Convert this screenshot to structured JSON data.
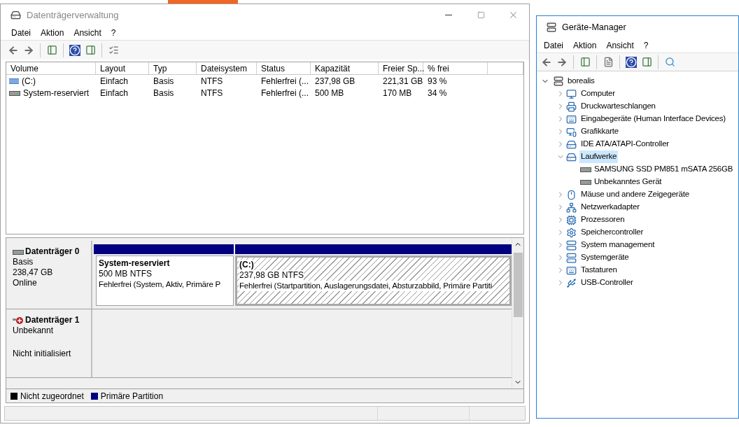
{
  "disk_management": {
    "title": "Datenträgerverwaltung",
    "menu": [
      "Datei",
      "Aktion",
      "Ansicht",
      "?"
    ],
    "volume_list": {
      "columns": [
        "Volume",
        "Layout",
        "Typ",
        "Dateisystem",
        "Status",
        "Kapazität",
        "Freier Sp...",
        "% frei"
      ],
      "rows": [
        {
          "kind": "striped",
          "cells": [
            "(C:)",
            "Einfach",
            "Basis",
            "NTFS",
            "Fehlerfrei (...",
            "237,98 GB",
            "221,31 GB",
            "93 %"
          ]
        },
        {
          "kind": "plain",
          "cells": [
            "System-reserviert",
            "Einfach",
            "Basis",
            "NTFS",
            "Fehlerfrei (...",
            "500 MB",
            "170 MB",
            "34 %"
          ]
        }
      ]
    },
    "disks": [
      {
        "kind": "online",
        "name": "Datenträger 0",
        "type": "Basis",
        "size": "238,47 GB",
        "state": "Online",
        "partitions": [
          {
            "name": "System-reserviert",
            "size": "500 MB NTFS",
            "status": "Fehlerfrei (System, Aktiv, Primäre P",
            "selected": false
          },
          {
            "name": "(C:)",
            "size": "237,98 GB NTFS",
            "status": "Fehlerfrei (Startpartition, Auslagerungsdatei, Absturzabbild, Primäre Partiti",
            "selected": true
          }
        ]
      },
      {
        "kind": "unknown",
        "name": "Datenträger 1",
        "type": "Unbekannt",
        "state": "Nicht initialisiert"
      }
    ],
    "legend": [
      {
        "label": "Nicht zugeordnet",
        "color": "#000000"
      },
      {
        "label": "Primäre Partition",
        "color": "#000080"
      }
    ]
  },
  "device_manager": {
    "title": "Geräte-Manager",
    "menu": [
      "Datei",
      "Aktion",
      "Ansicht",
      "?"
    ],
    "tree": {
      "label": "borealis",
      "expanded": true,
      "children": [
        {
          "label": "Computer",
          "expanded": false,
          "selected": false
        },
        {
          "label": "Druckwarteschlangen",
          "expanded": false,
          "selected": false
        },
        {
          "label": "Eingabegeräte (Human Interface Devices)",
          "expanded": false,
          "selected": false
        },
        {
          "label": "Grafikkarte",
          "expanded": false,
          "selected": false
        },
        {
          "label": "IDE ATA/ATAPI-Controller",
          "expanded": false,
          "selected": false
        },
        {
          "label": "Laufwerke",
          "expanded": true,
          "selected": true,
          "children": [
            {
              "label": "SAMSUNG SSD PM851 mSATA 256GB"
            },
            {
              "label": "Unbekanntes Gerät"
            }
          ]
        },
        {
          "label": "Mäuse und andere Zeigegeräte",
          "expanded": false,
          "selected": false
        },
        {
          "label": "Netzwerkadapter",
          "expanded": false,
          "selected": false
        },
        {
          "label": "Prozessoren",
          "expanded": false,
          "selected": false
        },
        {
          "label": "Speichercontroller",
          "expanded": false,
          "selected": false
        },
        {
          "label": "System management",
          "expanded": false,
          "selected": false
        },
        {
          "label": "Systemgeräte",
          "expanded": false,
          "selected": false
        },
        {
          "label": "Tastaturen",
          "expanded": false,
          "selected": false
        },
        {
          "label": "USB-Controller",
          "expanded": false,
          "selected": false
        }
      ]
    }
  }
}
